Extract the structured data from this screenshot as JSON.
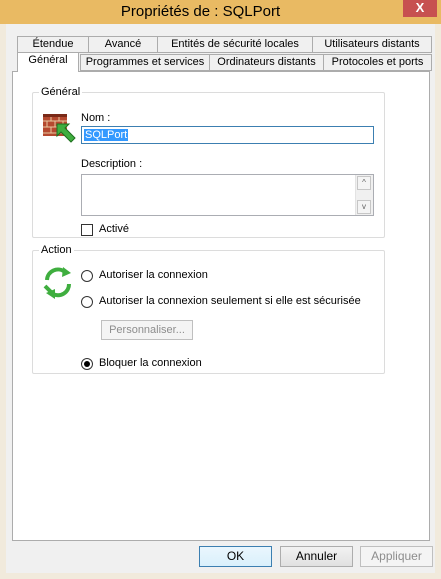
{
  "window": {
    "title": "Propriétés de : SQLPort",
    "close_glyph": "X"
  },
  "tabs_back": [
    "Étendue",
    "Avancé",
    "Entités de sécurité locales",
    "Utilisateurs distants"
  ],
  "tabs_front": [
    "Général",
    "Programmes et services",
    "Ordinateurs distants",
    "Protocoles et ports"
  ],
  "general": {
    "legend": "Général",
    "name_label": "Nom :",
    "name_value": "SQLPort",
    "description_label": "Description :",
    "description_value": "",
    "enabled_label": "Activé",
    "enabled_checked": false
  },
  "action": {
    "legend": "Action",
    "options": [
      {
        "label": "Autoriser la connexion",
        "checked": false
      },
      {
        "label": "Autoriser la connexion seulement si elle est sécurisée",
        "checked": false
      },
      {
        "label": "Bloquer la connexion",
        "checked": true
      }
    ],
    "customize_label": "Personnaliser..."
  },
  "buttons": {
    "ok": "OK",
    "cancel": "Annuler",
    "apply": "Appliquer"
  },
  "icons": {
    "scroll_up": "^",
    "scroll_down": "v"
  },
  "colors": {
    "titlebar": "#e9ba63",
    "close": "#c75050",
    "selection": "#3399ff"
  }
}
